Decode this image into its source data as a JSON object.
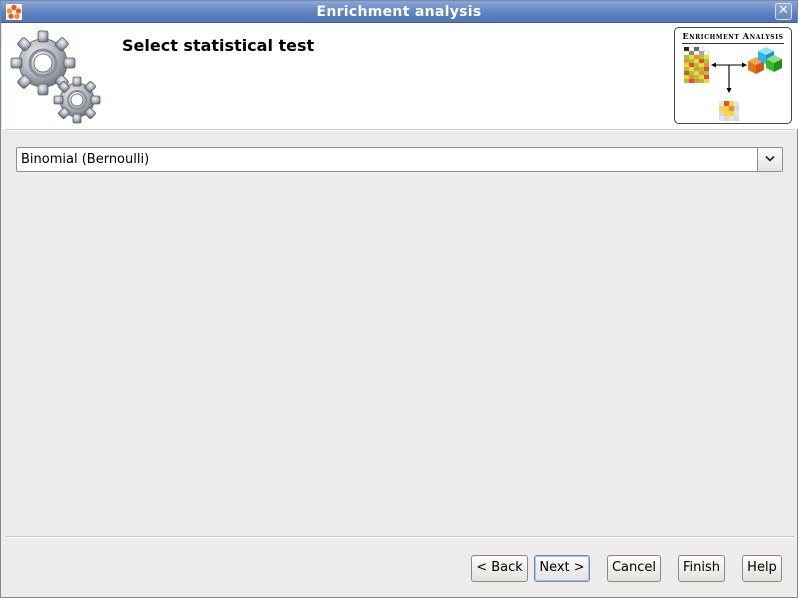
{
  "window": {
    "title": "Enrichment analysis",
    "close_glyph": "✕"
  },
  "header": {
    "heading": "Select statistical test",
    "logo_title": "Enrichment Analysis"
  },
  "test_select": {
    "selected_value": "Binomial (Bernoulli)"
  },
  "buttons": {
    "back": "< Back",
    "next": "Next >",
    "cancel": "Cancel",
    "finish": "Finish",
    "help": "Help"
  },
  "colors": {
    "titlebar": "#5f83c2",
    "dialog_bg": "#edecea",
    "header_bg": "#ffffff"
  },
  "icons": [
    "app-icon",
    "gears-icon",
    "enrichment-analysis-logo",
    "close-icon",
    "chevron-down-icon"
  ]
}
